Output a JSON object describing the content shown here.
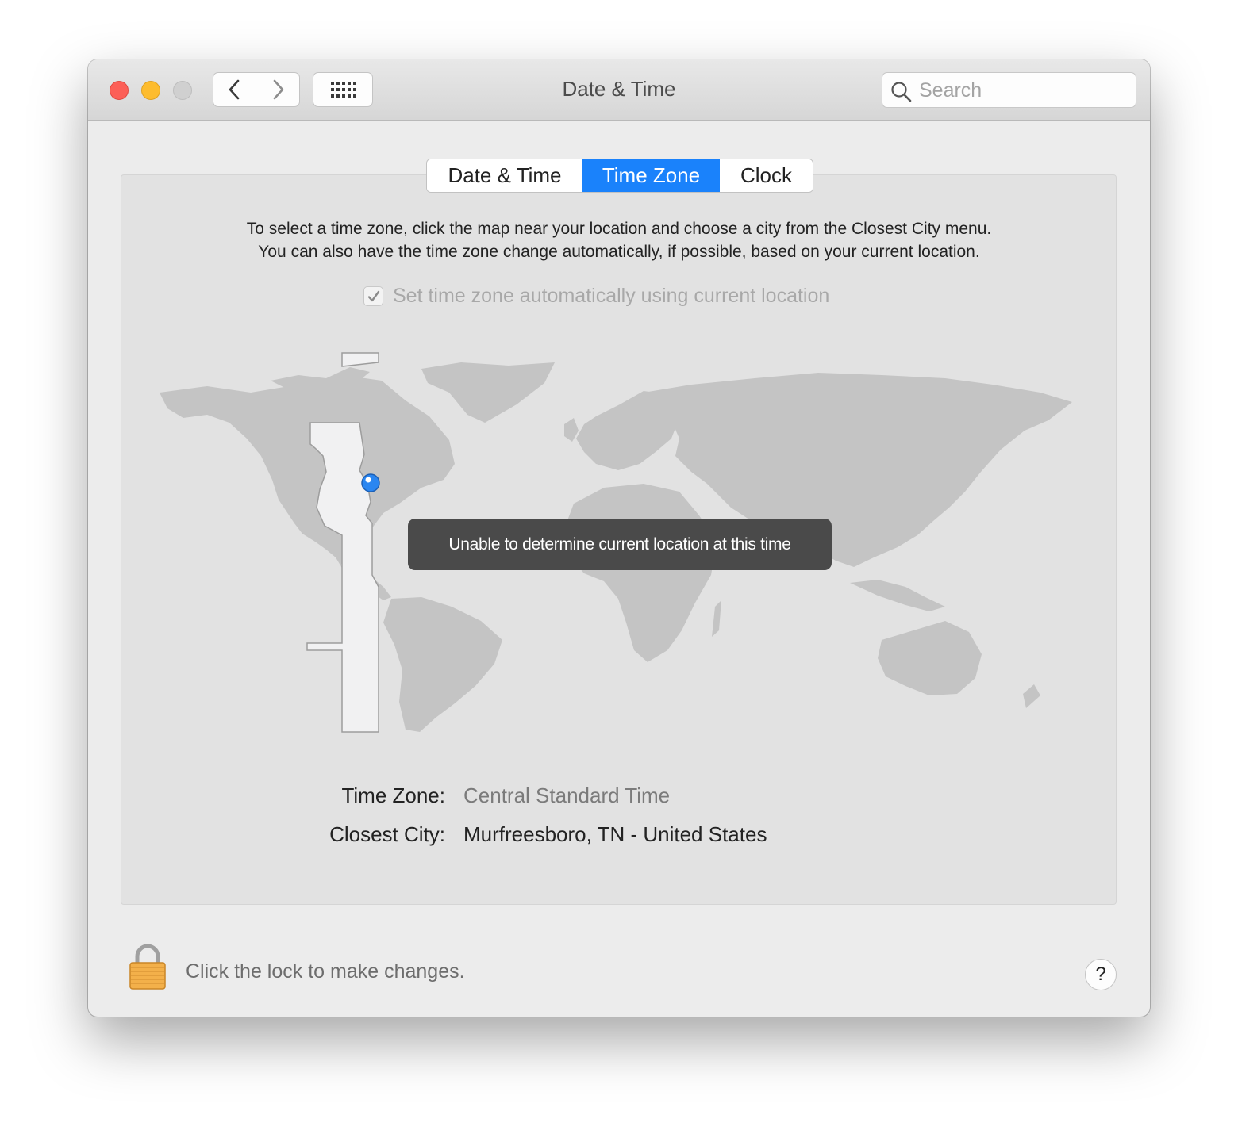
{
  "window": {
    "title": "Date & Time"
  },
  "search": {
    "placeholder": "Search"
  },
  "tabs": [
    {
      "label": "Date & Time",
      "selected": false
    },
    {
      "label": "Time Zone",
      "selected": true
    },
    {
      "label": "Clock",
      "selected": false
    }
  ],
  "instructions": {
    "line1": "To select a time zone, click the map near your location and choose a city from the Closest City menu.",
    "line2": "You can also have the time zone change automatically, if possible, based on your current location."
  },
  "auto_timezone": {
    "label": "Set time zone automatically using current location",
    "checked": true,
    "disabled": true
  },
  "map": {
    "toast": "Unable to determine current location at this time"
  },
  "info": {
    "timezone_label": "Time Zone:",
    "timezone_value": "Central Standard Time",
    "city_label": "Closest City:",
    "city_value": "Murfreesboro, TN - United States"
  },
  "footer": {
    "lock_text": "Click the lock to make changes.",
    "help_label": "?"
  },
  "colors": {
    "accent": "#1a82fb",
    "close": "#fc5f57",
    "minimize": "#fdbc2e",
    "land": "#c4c4c4",
    "selected_zone": "#f1f1f2"
  },
  "icons": [
    "chevron-left-icon",
    "chevron-right-icon",
    "grid-icon",
    "search-icon",
    "checkmark-icon",
    "location-pin-icon",
    "lock-icon"
  ]
}
